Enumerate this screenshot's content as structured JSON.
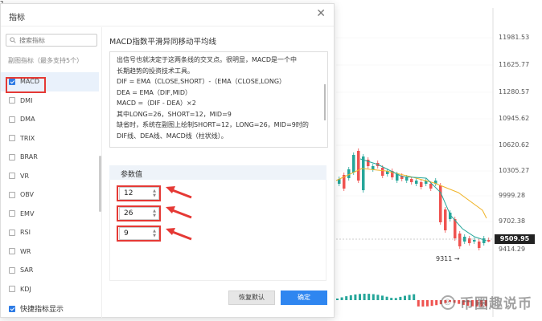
{
  "top_tick": "2",
  "dialog": {
    "title": "指标",
    "close_label": "✕"
  },
  "left_panel": {
    "search_placeholder": "搜索指标",
    "subchart_hint": "副图指标（最多支持5个）",
    "items": [
      {
        "label": "MACD",
        "checked": true
      },
      {
        "label": "DMI",
        "checked": false
      },
      {
        "label": "DMA",
        "checked": false
      },
      {
        "label": "TRIX",
        "checked": false
      },
      {
        "label": "BRAR",
        "checked": false
      },
      {
        "label": "VR",
        "checked": false
      },
      {
        "label": "OBV",
        "checked": false
      },
      {
        "label": "EMV",
        "checked": false
      },
      {
        "label": "RSI",
        "checked": false
      },
      {
        "label": "WR",
        "checked": false
      },
      {
        "label": "SAR",
        "checked": false
      },
      {
        "label": "KDJ",
        "checked": false
      }
    ],
    "footer_toggle": "快捷指标显示"
  },
  "right_panel": {
    "desc_title": "MACD指数平滑异同移动平均线",
    "desc_lines": [
      "出信号也就决定于这两条线的交叉点。很明显，MACD是一个中",
      "长期趋势的投资技术工具。",
      "DIF = EMA（CLOSE,SHORT）-（EMA（CLOSE,LONG）",
      "DEA = EMA（DIF,MID）",
      "MACD =（DIF - DEA）×2",
      "其中LONG=26，SHORT=12，MID=9",
      "缺省时，系统在副图上绘制SHORT=12，LONG=26，MID=9时的",
      "DIF线、DEA线、MACD线（柱状线）。"
    ],
    "param_title": "参数值",
    "params": [
      "12",
      "26",
      "9"
    ],
    "reset_label": "恢复默认",
    "ok_label": "确定"
  },
  "chart": {
    "price_labels": [
      "11981.53",
      "11625.77",
      "11280.57",
      "10945.62",
      "10620.62",
      "10305.27",
      "9999.28",
      "9702.38",
      "9414.29"
    ],
    "current_price": "9509.95",
    "min_label": "9311 →",
    "up_color": "#26a69a",
    "down_color": "#ef5350"
  },
  "watermark": "币圈趣说币"
}
